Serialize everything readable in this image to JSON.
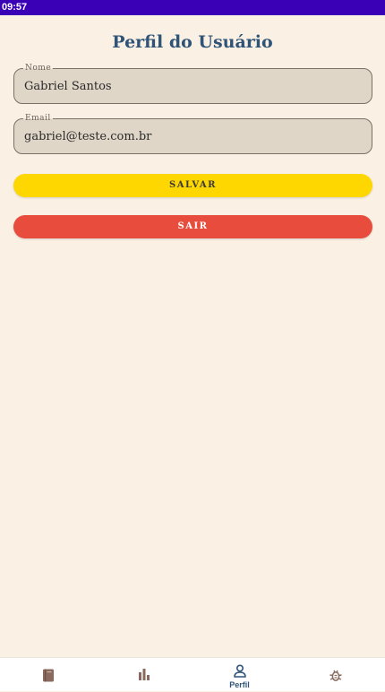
{
  "status_bar": {
    "time": "09:57"
  },
  "page": {
    "title": "Perfil do Usuário"
  },
  "form": {
    "name_label": "Nome",
    "name_value": "Gabriel Santos",
    "email_label": "Email",
    "email_value": "gabriel@teste.com.br"
  },
  "buttons": {
    "save_label": "SALVAR",
    "exit_label": "SAIR"
  },
  "bottom_nav": {
    "items": [
      {
        "icon": "book-icon",
        "label": ""
      },
      {
        "icon": "bar-chart-icon",
        "label": ""
      },
      {
        "icon": "person-icon",
        "label": "Perfil"
      },
      {
        "icon": "bug-icon",
        "label": ""
      }
    ],
    "active_index": 2
  },
  "colors": {
    "status_bar": "#3A00B5",
    "background": "#FAF1E4",
    "title": "#2F5478",
    "field_fill": "#DFD6C8",
    "save_button": "#FFD700",
    "exit_button": "#E84C3D",
    "nav_inactive_icon": "#8A6A5E",
    "nav_active": "#2F5478"
  }
}
